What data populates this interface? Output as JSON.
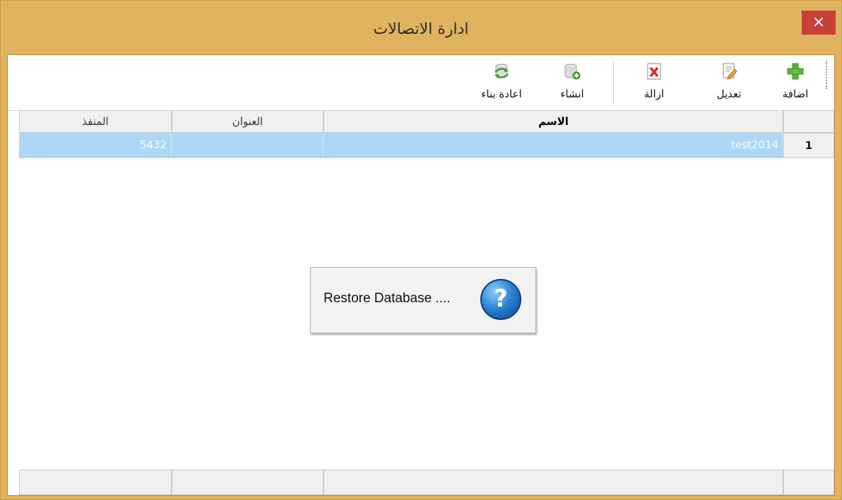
{
  "window": {
    "title": "ادارة الاتصالات",
    "close_glyph": "×"
  },
  "toolbar": {
    "buttons": [
      {
        "label": "اضافة",
        "icon": "add-icon"
      },
      {
        "label": "تعديل",
        "icon": "edit-icon"
      },
      {
        "label": "ازالة",
        "icon": "delete-icon"
      },
      {
        "label": "انشاء",
        "icon": "create-db-icon"
      },
      {
        "label": "اعادة بناء",
        "icon": "rebuild-db-icon"
      }
    ]
  },
  "grid": {
    "columns": [
      {
        "label": "الاسم"
      },
      {
        "label": "العنوان"
      },
      {
        "label": "المنفذ"
      }
    ],
    "rows": [
      {
        "num": "1",
        "name": "test2014",
        "address": "",
        "port": "5432"
      }
    ]
  },
  "dialog": {
    "message": "Restore Database ....",
    "icon": "question-icon",
    "icon_glyph": "?"
  },
  "colors": {
    "frame": "#e0b45e",
    "close": "#c7403a",
    "selection": "#add7f6"
  }
}
